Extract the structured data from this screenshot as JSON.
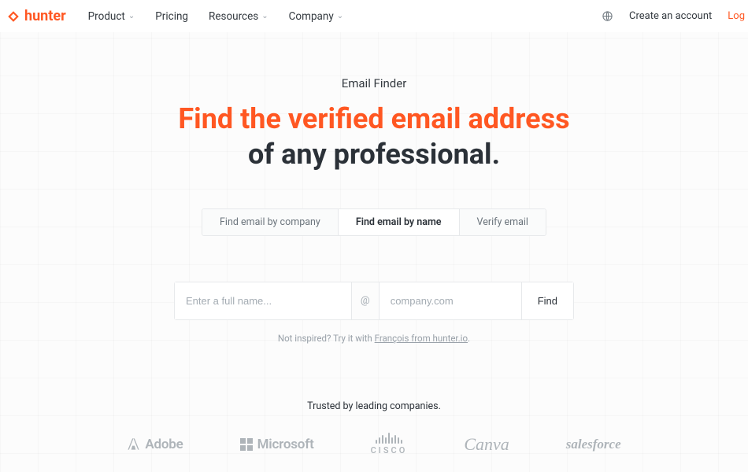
{
  "brand": {
    "name": "hunter"
  },
  "nav": {
    "items": [
      {
        "label": "Product",
        "has_chevron": true
      },
      {
        "label": "Pricing",
        "has_chevron": false
      },
      {
        "label": "Resources",
        "has_chevron": true
      },
      {
        "label": "Company",
        "has_chevron": true
      }
    ],
    "create_account": "Create an account",
    "login": "Log"
  },
  "hero": {
    "kicker": "Email Finder",
    "headline_orange": "Find the verified email address",
    "headline_dark": "of any professional."
  },
  "tabs": [
    {
      "label": "Find email by company",
      "active": false
    },
    {
      "label": "Find email by name",
      "active": true
    },
    {
      "label": "Verify email",
      "active": false
    }
  ],
  "search": {
    "name_placeholder": "Enter a full name...",
    "at": "@",
    "domain_placeholder": "company.com",
    "button": "Find"
  },
  "tip": {
    "prefix": "Not inspired? Try it with ",
    "link": "François from hunter.io",
    "suffix": "."
  },
  "trust": {
    "line": "Trusted by leading companies.",
    "brands": {
      "adobe": "Adobe",
      "microsoft": "Microsoft",
      "cisco": "CISCO",
      "canva": "Canva",
      "salesforce": "salesforce"
    }
  },
  "colors": {
    "accent": "#ff5722"
  }
}
